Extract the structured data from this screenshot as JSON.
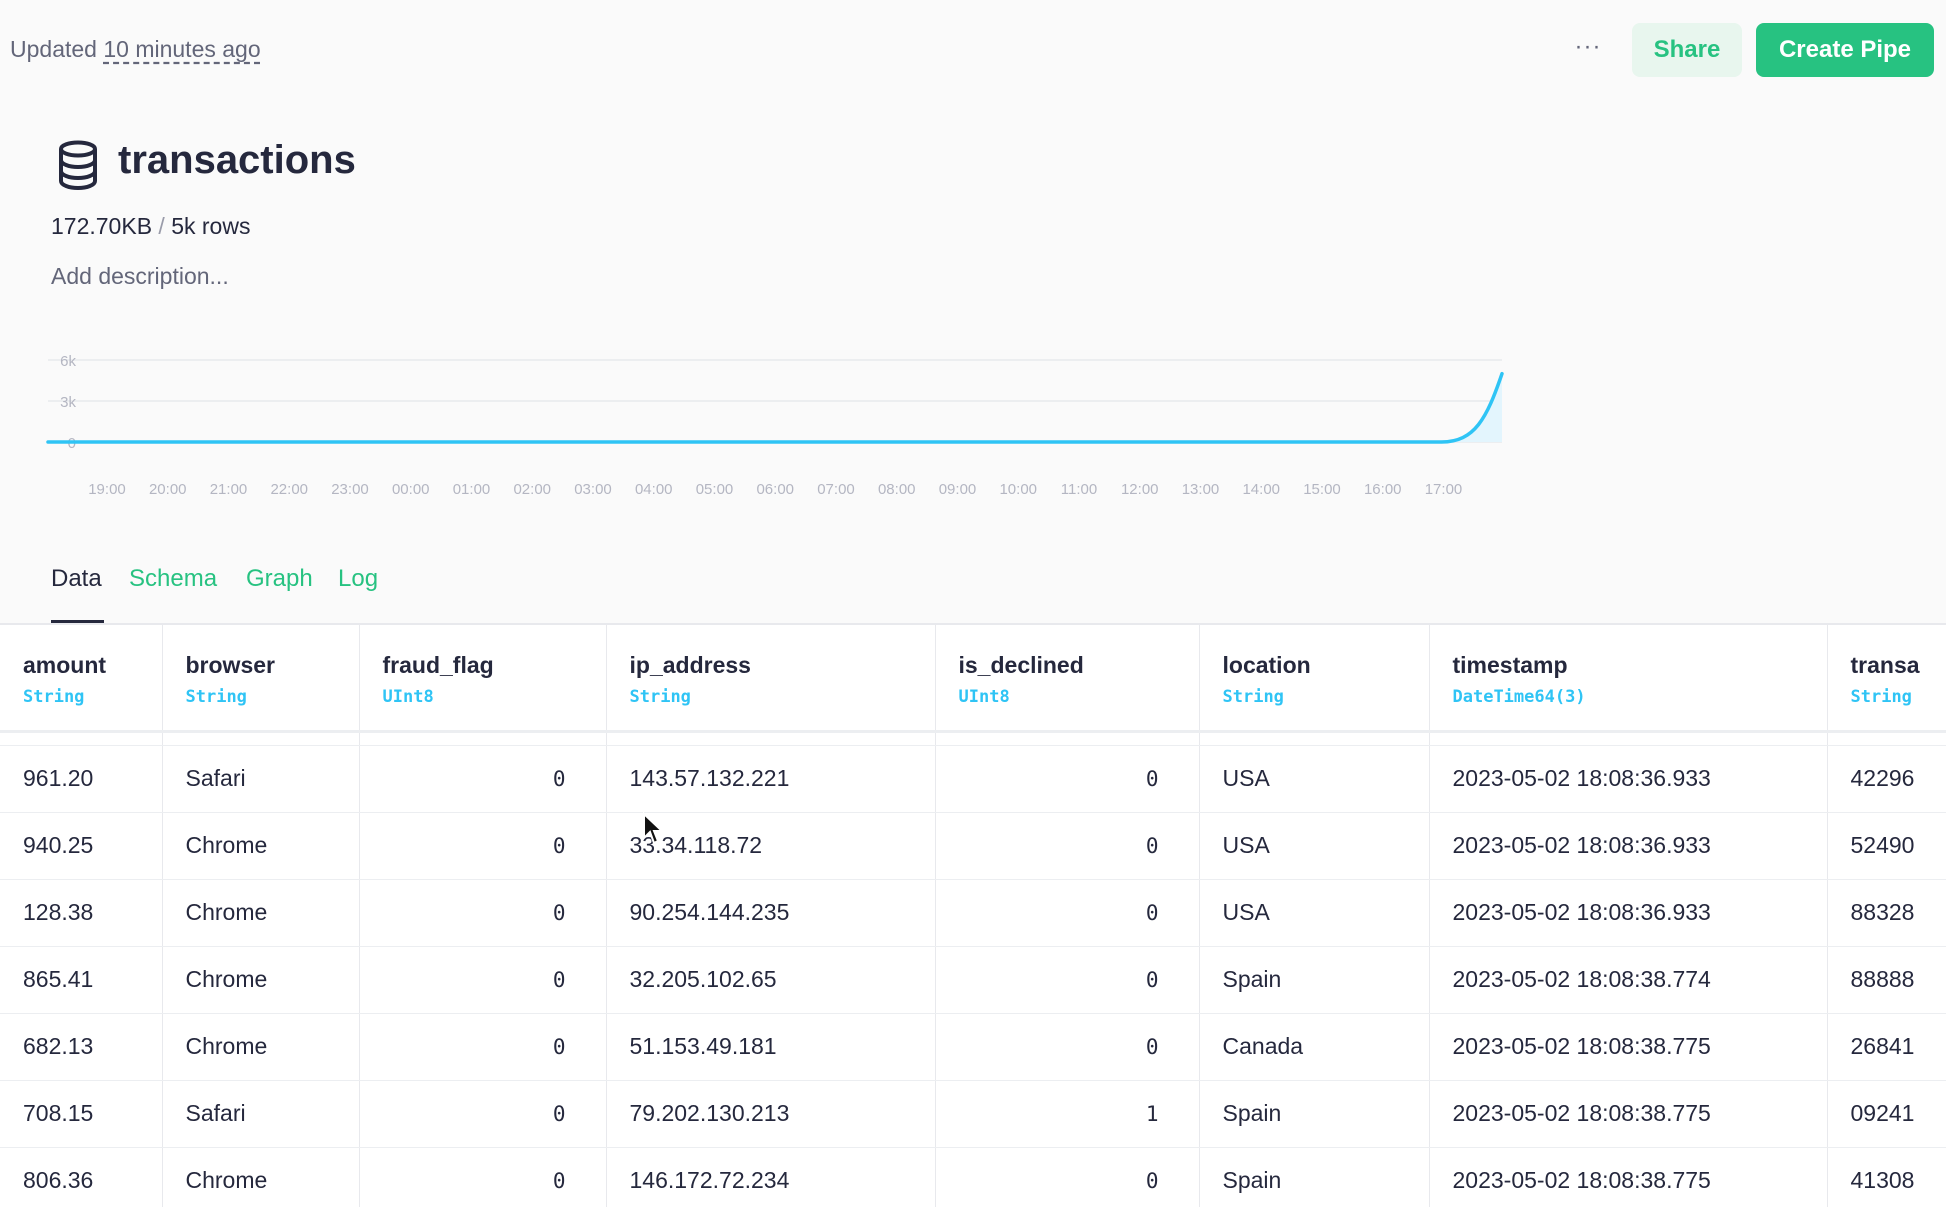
{
  "topbar": {
    "updated_prefix": "Updated",
    "updated_time": "10 minutes ago",
    "more_label": "···",
    "share_label": "Share",
    "create_label": "Create Pipe"
  },
  "datasource": {
    "icon": "database-icon",
    "name": "transactions",
    "size": "172.70KB",
    "separator": "/",
    "rows": "5k rows",
    "description_placeholder": "Add description..."
  },
  "chart_data": {
    "type": "area",
    "x": [
      "19:00",
      "20:00",
      "21:00",
      "22:00",
      "23:00",
      "00:00",
      "01:00",
      "02:00",
      "03:00",
      "04:00",
      "05:00",
      "06:00",
      "07:00",
      "08:00",
      "09:00",
      "10:00",
      "11:00",
      "12:00",
      "13:00",
      "14:00",
      "15:00",
      "16:00",
      "17:00"
    ],
    "y_ticks": [
      "6k",
      "3k",
      "0"
    ],
    "ylim": [
      0,
      6000
    ],
    "series": [
      {
        "values": [
          0,
          0,
          0,
          0,
          0,
          0,
          0,
          0,
          0,
          0,
          0,
          0,
          0,
          0,
          0,
          0,
          0,
          0,
          0,
          0,
          0,
          0,
          0,
          5000
        ]
      }
    ],
    "colors": {
      "line": "#2fc4f5",
      "fill": "#e3f5fd",
      "grid": "#e8e9ed",
      "tick": "#b4b6c2"
    },
    "grid": true
  },
  "tabs": [
    {
      "label": "Data",
      "active": true
    },
    {
      "label": "Schema",
      "active": false
    },
    {
      "label": "Graph",
      "active": false
    },
    {
      "label": "Log",
      "active": false
    }
  ],
  "table": {
    "columns": [
      {
        "name": "amount",
        "type": "String"
      },
      {
        "name": "browser",
        "type": "String"
      },
      {
        "name": "fraud_flag",
        "type": "UInt8"
      },
      {
        "name": "ip_address",
        "type": "String"
      },
      {
        "name": "is_declined",
        "type": "UInt8"
      },
      {
        "name": "location",
        "type": "String"
      },
      {
        "name": "timestamp",
        "type": "DateTime64(3)"
      },
      {
        "name": "transa",
        "type": "String"
      }
    ],
    "rows": [
      [
        "961.20",
        "Safari",
        "0",
        "143.57.132.221",
        "0",
        "USA",
        "2023-05-02 18:08:36.933",
        "42296"
      ],
      [
        "940.25",
        "Chrome",
        "0",
        "33.34.118.72",
        "0",
        "USA",
        "2023-05-02 18:08:36.933",
        "52490"
      ],
      [
        "128.38",
        "Chrome",
        "0",
        "90.254.144.235",
        "0",
        "USA",
        "2023-05-02 18:08:36.933",
        "88328"
      ],
      [
        "865.41",
        "Chrome",
        "0",
        "32.205.102.65",
        "0",
        "Spain",
        "2023-05-02 18:08:38.774",
        "88888"
      ],
      [
        "682.13",
        "Chrome",
        "0",
        "51.153.49.181",
        "0",
        "Canada",
        "2023-05-02 18:08:38.775",
        "26841"
      ],
      [
        "708.15",
        "Safari",
        "0",
        "79.202.130.213",
        "1",
        "Spain",
        "2023-05-02 18:08:38.775",
        "09241"
      ],
      [
        "806.36",
        "Chrome",
        "0",
        "146.172.72.234",
        "0",
        "Spain",
        "2023-05-02 18:08:38.775",
        "41308"
      ]
    ]
  },
  "colors": {
    "accent": "#27c281",
    "accent_soft": "#e8f6ee",
    "type_label": "#2fc4f5",
    "text": "#25283d",
    "muted": "#636679"
  }
}
